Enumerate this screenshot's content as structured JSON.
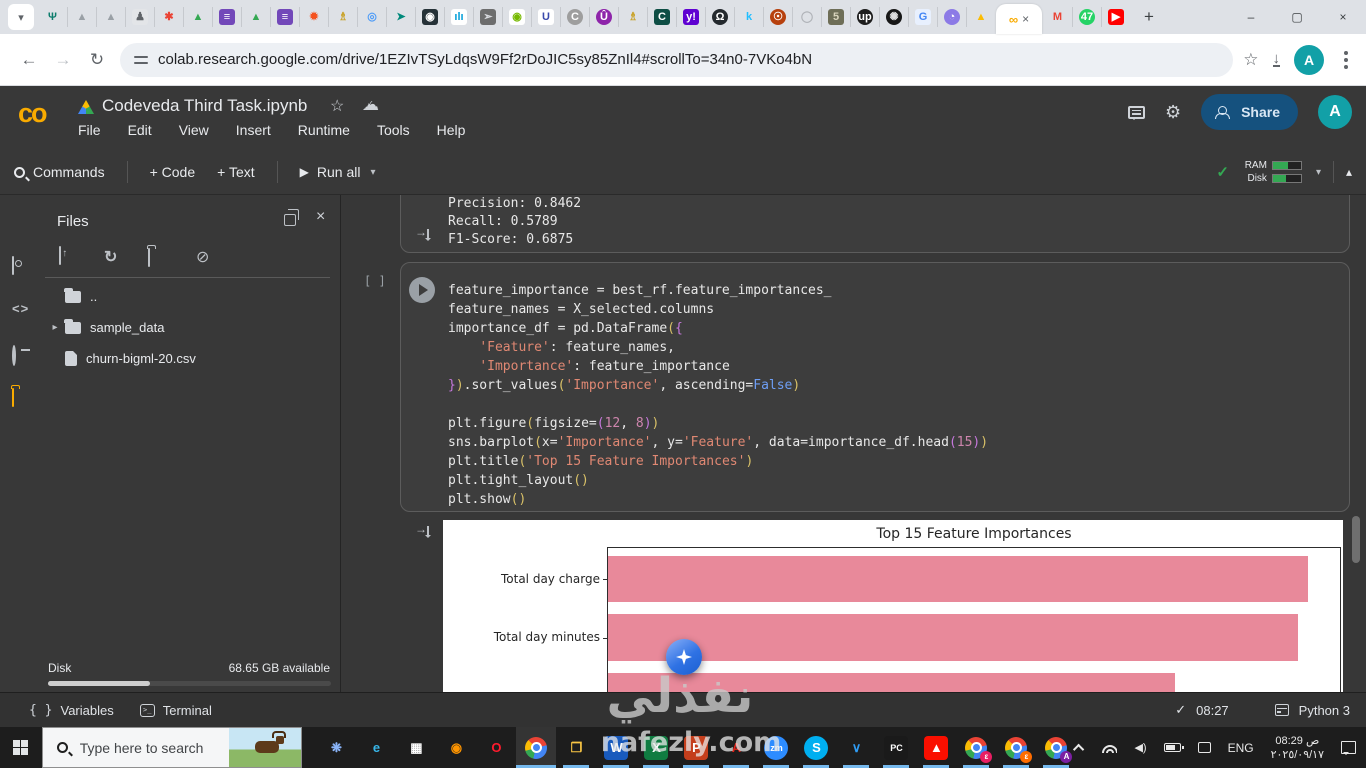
{
  "browser": {
    "url": "colab.research.google.com/drive/1EZIvTSyLdqsW9Ff2rDoJIC5sy85ZnIl4#scrollTo=34n0-7VKo4bN",
    "active_tab": {
      "favicon_glyph": "∞",
      "close_glyph": "×"
    },
    "new_tab_glyph": "+",
    "window_controls": {
      "minimize": "–",
      "maximize": "▢",
      "close": "×"
    },
    "tab_scroll_glyph": "▾",
    "pinned_favicons": [
      {
        "name": "tree-site-favicon",
        "glyph": "Ψ",
        "fg": "#0e7d6d",
        "bg": "",
        "round": false
      },
      {
        "name": "gray-triangle-favicon",
        "glyph": "▲",
        "fg": "#9aa0a6",
        "bg": "",
        "round": false
      },
      {
        "name": "gray-triangle-favicon",
        "glyph": "▲",
        "fg": "#9aa0a6",
        "bg": "",
        "round": false
      },
      {
        "name": "contact-card-favicon",
        "glyph": "♟",
        "fg": "#5f6368",
        "bg": "#e3e5e8",
        "round": false
      },
      {
        "name": "google-ads-favicon",
        "glyph": "✱",
        "fg": "#ea4335",
        "bg": "",
        "round": false
      },
      {
        "name": "google-drive-favicon",
        "glyph": "▲",
        "fg": "#34a853",
        "bg": "",
        "round": false
      },
      {
        "name": "google-forms-favicon",
        "glyph": "≡",
        "fg": "#ffffff",
        "bg": "#7248b9",
        "round": false
      },
      {
        "name": "google-drive-favicon",
        "glyph": "▲",
        "fg": "#34a853",
        "bg": "",
        "round": false
      },
      {
        "name": "google-forms-favicon",
        "glyph": "≡",
        "fg": "#ffffff",
        "bg": "#7248b9",
        "round": false
      },
      {
        "name": "orange-burst-favicon",
        "glyph": "✹",
        "fg": "#f4511e",
        "bg": "",
        "round": false
      },
      {
        "name": "gold-trophy-favicon",
        "glyph": "♗",
        "fg": "#c9a227",
        "bg": "",
        "round": false
      },
      {
        "name": "blue-rings-favicon",
        "glyph": "◎",
        "fg": "#4f9cf7",
        "bg": "",
        "round": false
      },
      {
        "name": "teal-arrow-favicon",
        "glyph": "➤",
        "fg": "#00897b",
        "bg": "",
        "round": false
      },
      {
        "name": "hp-life-favicon",
        "glyph": "◉",
        "fg": "#ffffff",
        "bg": "#263238",
        "round": false
      },
      {
        "name": "cisco-favicon",
        "glyph": "ılı",
        "fg": "#049fd9",
        "bg": "#ffffff",
        "round": false
      },
      {
        "name": "cursor-tool-favicon",
        "glyph": "➢",
        "fg": "#dadce0",
        "bg": "#6d6d6d",
        "round": false
      },
      {
        "name": "nvidia-favicon",
        "glyph": "◉",
        "fg": "#76b900",
        "bg": "#ffffff",
        "round": false
      },
      {
        "name": "u-letter-favicon",
        "glyph": "U",
        "fg": "#3949ab",
        "bg": "#ffffff",
        "round": false
      },
      {
        "name": "gray-c-favicon",
        "glyph": "C",
        "fg": "#ffffff",
        "bg": "#9e9e9e",
        "round": true
      },
      {
        "name": "purple-shield-favicon",
        "glyph": "Û",
        "fg": "#ffffff",
        "bg": "#8e24aa",
        "round": true
      },
      {
        "name": "gold-trophy-favicon",
        "glyph": "♗",
        "fg": "#c9a227",
        "bg": "",
        "round": false
      },
      {
        "name": "credly-favicon",
        "glyph": "C",
        "fg": "#ffffff",
        "bg": "#0e4e45",
        "round": false
      },
      {
        "name": "yahoo-favicon",
        "glyph": "y!",
        "fg": "#ffffff",
        "bg": "#5f01d1",
        "round": false
      },
      {
        "name": "github-favicon",
        "glyph": "Ω",
        "fg": "#ffffff",
        "bg": "#24292e",
        "round": true
      },
      {
        "name": "kaggle-favicon",
        "glyph": "k",
        "fg": "#20beff",
        "bg": "",
        "round": false
      },
      {
        "name": "red-creature-favicon",
        "glyph": "☉",
        "fg": "#ffffff",
        "bg": "#b7410e",
        "round": true
      },
      {
        "name": "gray-ring-favicon",
        "glyph": "◯",
        "fg": "#b0b3b8",
        "bg": "",
        "round": false
      },
      {
        "name": "five-favicon",
        "glyph": "5",
        "fg": "#d9d4bd",
        "bg": "#6e6e57",
        "round": false
      },
      {
        "name": "upwork-favicon",
        "glyph": "up",
        "fg": "#ffffff",
        "bg": "#1d1d1d",
        "round": true
      },
      {
        "name": "knot-favicon",
        "glyph": "✺",
        "fg": "#dddddd",
        "bg": "#171717",
        "round": true
      },
      {
        "name": "g-doc-favicon",
        "glyph": "G",
        "fg": "#4285f4",
        "bg": "#e8f0fe",
        "round": false
      },
      {
        "name": "purple-meet-favicon",
        "glyph": "◔",
        "fg": "#ffffff",
        "bg": "#8c7ae6",
        "round": true
      },
      {
        "name": "google-drive-favicon",
        "glyph": "▲",
        "fg": "#fbbc04",
        "bg": "",
        "round": false
      }
    ],
    "tail_favicons": [
      {
        "name": "gmail-favicon",
        "glyph": "M",
        "fg": "#ea4335",
        "bg": "",
        "round": false
      },
      {
        "name": "whatsapp-unread-favicon",
        "glyph": "47",
        "fg": "#ffffff",
        "bg": "#25d366",
        "round": true
      },
      {
        "name": "youtube-favicon",
        "glyph": "▶",
        "fg": "#ffffff",
        "bg": "#ff0000",
        "round": false
      }
    ]
  },
  "colab": {
    "logo_text": "co",
    "title": "Codeveda Third Task.ipynb",
    "menus": [
      "File",
      "Edit",
      "View",
      "Insert",
      "Runtime",
      "Tools",
      "Help"
    ],
    "share_label": "Share",
    "avatar_letter": "A",
    "toolbar": {
      "commands": "Commands",
      "add_code": "+ Code",
      "add_text": "+ Text",
      "run_all": "Run all",
      "ram_label": "RAM",
      "disk_label": "Disk"
    },
    "sidebar": {
      "title": "Files",
      "tree": [
        {
          "type": "folder-open",
          "label": "..",
          "expandable": false
        },
        {
          "type": "folder",
          "label": "sample_data",
          "expandable": true
        },
        {
          "type": "file",
          "label": "churn-bigml-20.csv",
          "expandable": false
        }
      ],
      "disk_label": "Disk",
      "disk_available": "68.65 GB available"
    },
    "cells": {
      "prev_output_lines": [
        "Precision: 0.8462",
        "Recall: 0.5789",
        "F1-Score: 0.6875"
      ],
      "exec_indicator": "[ ]",
      "code_lines": [
        [
          [
            "d",
            "feature_importance = best_rf.feature_importances_"
          ]
        ],
        [
          [
            "d",
            "feature_names = X_selected.columns"
          ]
        ],
        [
          [
            "d",
            "importance_df = pd.DataFrame"
          ],
          [
            "y",
            "("
          ],
          [
            "p",
            "{"
          ]
        ],
        [
          [
            "d",
            "    "
          ],
          [
            "s",
            "'Feature'"
          ],
          [
            "d",
            ": feature_names,"
          ]
        ],
        [
          [
            "d",
            "    "
          ],
          [
            "s",
            "'Importance'"
          ],
          [
            "d",
            ": feature_importance"
          ]
        ],
        [
          [
            "p",
            "}"
          ],
          [
            "y",
            ")"
          ],
          [
            "d",
            ".sort_values"
          ],
          [
            "y",
            "("
          ],
          [
            "s",
            "'Importance'"
          ],
          [
            "d",
            ", ascending="
          ],
          [
            "k",
            "False"
          ],
          [
            "y",
            ")"
          ]
        ],
        [],
        [
          [
            "d",
            "plt.figure"
          ],
          [
            "y",
            "("
          ],
          [
            "d",
            "figsize="
          ],
          [
            "p",
            "("
          ],
          [
            "n",
            "12"
          ],
          [
            "d",
            ", "
          ],
          [
            "n",
            "8"
          ],
          [
            "p",
            ")"
          ],
          [
            "y",
            ")"
          ]
        ],
        [
          [
            "d",
            "sns.barplot"
          ],
          [
            "y",
            "("
          ],
          [
            "d",
            "x="
          ],
          [
            "s",
            "'Importance'"
          ],
          [
            "d",
            ", y="
          ],
          [
            "s",
            "'Feature'"
          ],
          [
            "d",
            ", data=importance_df.head"
          ],
          [
            "p",
            "("
          ],
          [
            "n",
            "15"
          ],
          [
            "p",
            ")"
          ],
          [
            "y",
            ")"
          ]
        ],
        [
          [
            "d",
            "plt.title"
          ],
          [
            "y",
            "("
          ],
          [
            "s",
            "'Top 15 Feature Importances'"
          ],
          [
            "y",
            ")"
          ]
        ],
        [
          [
            "d",
            "plt.tight_layout"
          ],
          [
            "y",
            "()"
          ]
        ],
        [
          [
            "d",
            "plt.show"
          ],
          [
            "y",
            "()"
          ]
        ]
      ]
    },
    "footer": {
      "variables": "Variables",
      "terminal": "Terminal",
      "status_time": "08:27",
      "kernel": "Python 3"
    }
  },
  "chart_data": {
    "type": "bar",
    "orientation": "horizontal",
    "title": "Top 15 Feature Importances",
    "categories": [
      "Total day charge",
      "Total day minutes",
      ""
    ],
    "values": [
      1.0,
      0.985,
      0.81
    ],
    "value_note": "relative bar lengths; x-axis scale cut off below viewport",
    "total_bars": 15,
    "visible_bars": 3,
    "bar_color": "#e8899a",
    "background": "#ffffff",
    "grid": false,
    "legend": false
  },
  "taskbar": {
    "search_placeholder": "Type here to search",
    "apps": [
      {
        "name": "copilot",
        "glyph": "❋",
        "fg": "#8ab4f8",
        "bg": "",
        "round": false,
        "underline": false
      },
      {
        "name": "edge",
        "glyph": "e",
        "fg": "#38b6e8",
        "bg": "",
        "round": false,
        "underline": false
      },
      {
        "name": "microsoft-store",
        "glyph": "▦",
        "fg": "#ffffff",
        "bg": "",
        "round": false,
        "underline": false
      },
      {
        "name": "firefox",
        "glyph": "◉",
        "fg": "#ff9500",
        "bg": "",
        "round": false,
        "underline": false
      },
      {
        "name": "opera",
        "glyph": "O",
        "fg": "#ff1b2d",
        "bg": "",
        "round": false,
        "underline": false
      },
      {
        "name": "chrome",
        "chrome": true,
        "active": true,
        "underline": true
      },
      {
        "name": "file-explorer",
        "glyph": "❒",
        "fg": "#f8c544",
        "bg": "",
        "round": false,
        "underline": true
      },
      {
        "name": "word",
        "glyph": "W",
        "fg": "#ffffff",
        "bg": "#185abd",
        "round": false,
        "underline": true
      },
      {
        "name": "excel",
        "glyph": "X",
        "fg": "#ffffff",
        "bg": "#107c41",
        "round": false,
        "underline": true
      },
      {
        "name": "powerpoint",
        "glyph": "P",
        "fg": "#ffffff",
        "bg": "#c43e1c",
        "round": false,
        "underline": true
      },
      {
        "name": "adobe-a",
        "glyph": "A",
        "fg": "#e2231a",
        "bg": "",
        "round": false,
        "underline": true
      },
      {
        "name": "zoom",
        "glyph": "zm",
        "fg": "#ffffff",
        "bg": "#2d8cff",
        "round": true,
        "underline": true
      },
      {
        "name": "skype",
        "glyph": "S",
        "fg": "#ffffff",
        "bg": "#00aff0",
        "round": true,
        "underline": true
      },
      {
        "name": "vscode",
        "glyph": "∨",
        "fg": "#2f9cf4",
        "bg": "",
        "round": false,
        "underline": true
      },
      {
        "name": "pycharm",
        "glyph": "PC",
        "fg": "#ffffff",
        "bg": "#1a1a1a",
        "round": false,
        "underline": true
      },
      {
        "name": "acrobat",
        "glyph": "▲",
        "fg": "#ffffff",
        "bg": "#fa0f00",
        "round": false,
        "underline": true
      },
      {
        "name": "chrome-profile-1",
        "chrome": true,
        "badge": "ε",
        "badge_bg": "#e91e63",
        "underline": true
      },
      {
        "name": "chrome-profile-2",
        "chrome": true,
        "badge": "ε",
        "badge_bg": "#ff6d00",
        "underline": true
      },
      {
        "name": "chrome-profile-3",
        "chrome": true,
        "badge": "A",
        "badge_bg": "#7b1fa2",
        "underline": true
      }
    ],
    "tray": {
      "language": "ENG",
      "time": "08:29 ص",
      "date": "٢٠٢٥/٠٩/١٧"
    }
  },
  "watermark": {
    "arabic": "نفذلي",
    "domain": "nafezly.com"
  }
}
